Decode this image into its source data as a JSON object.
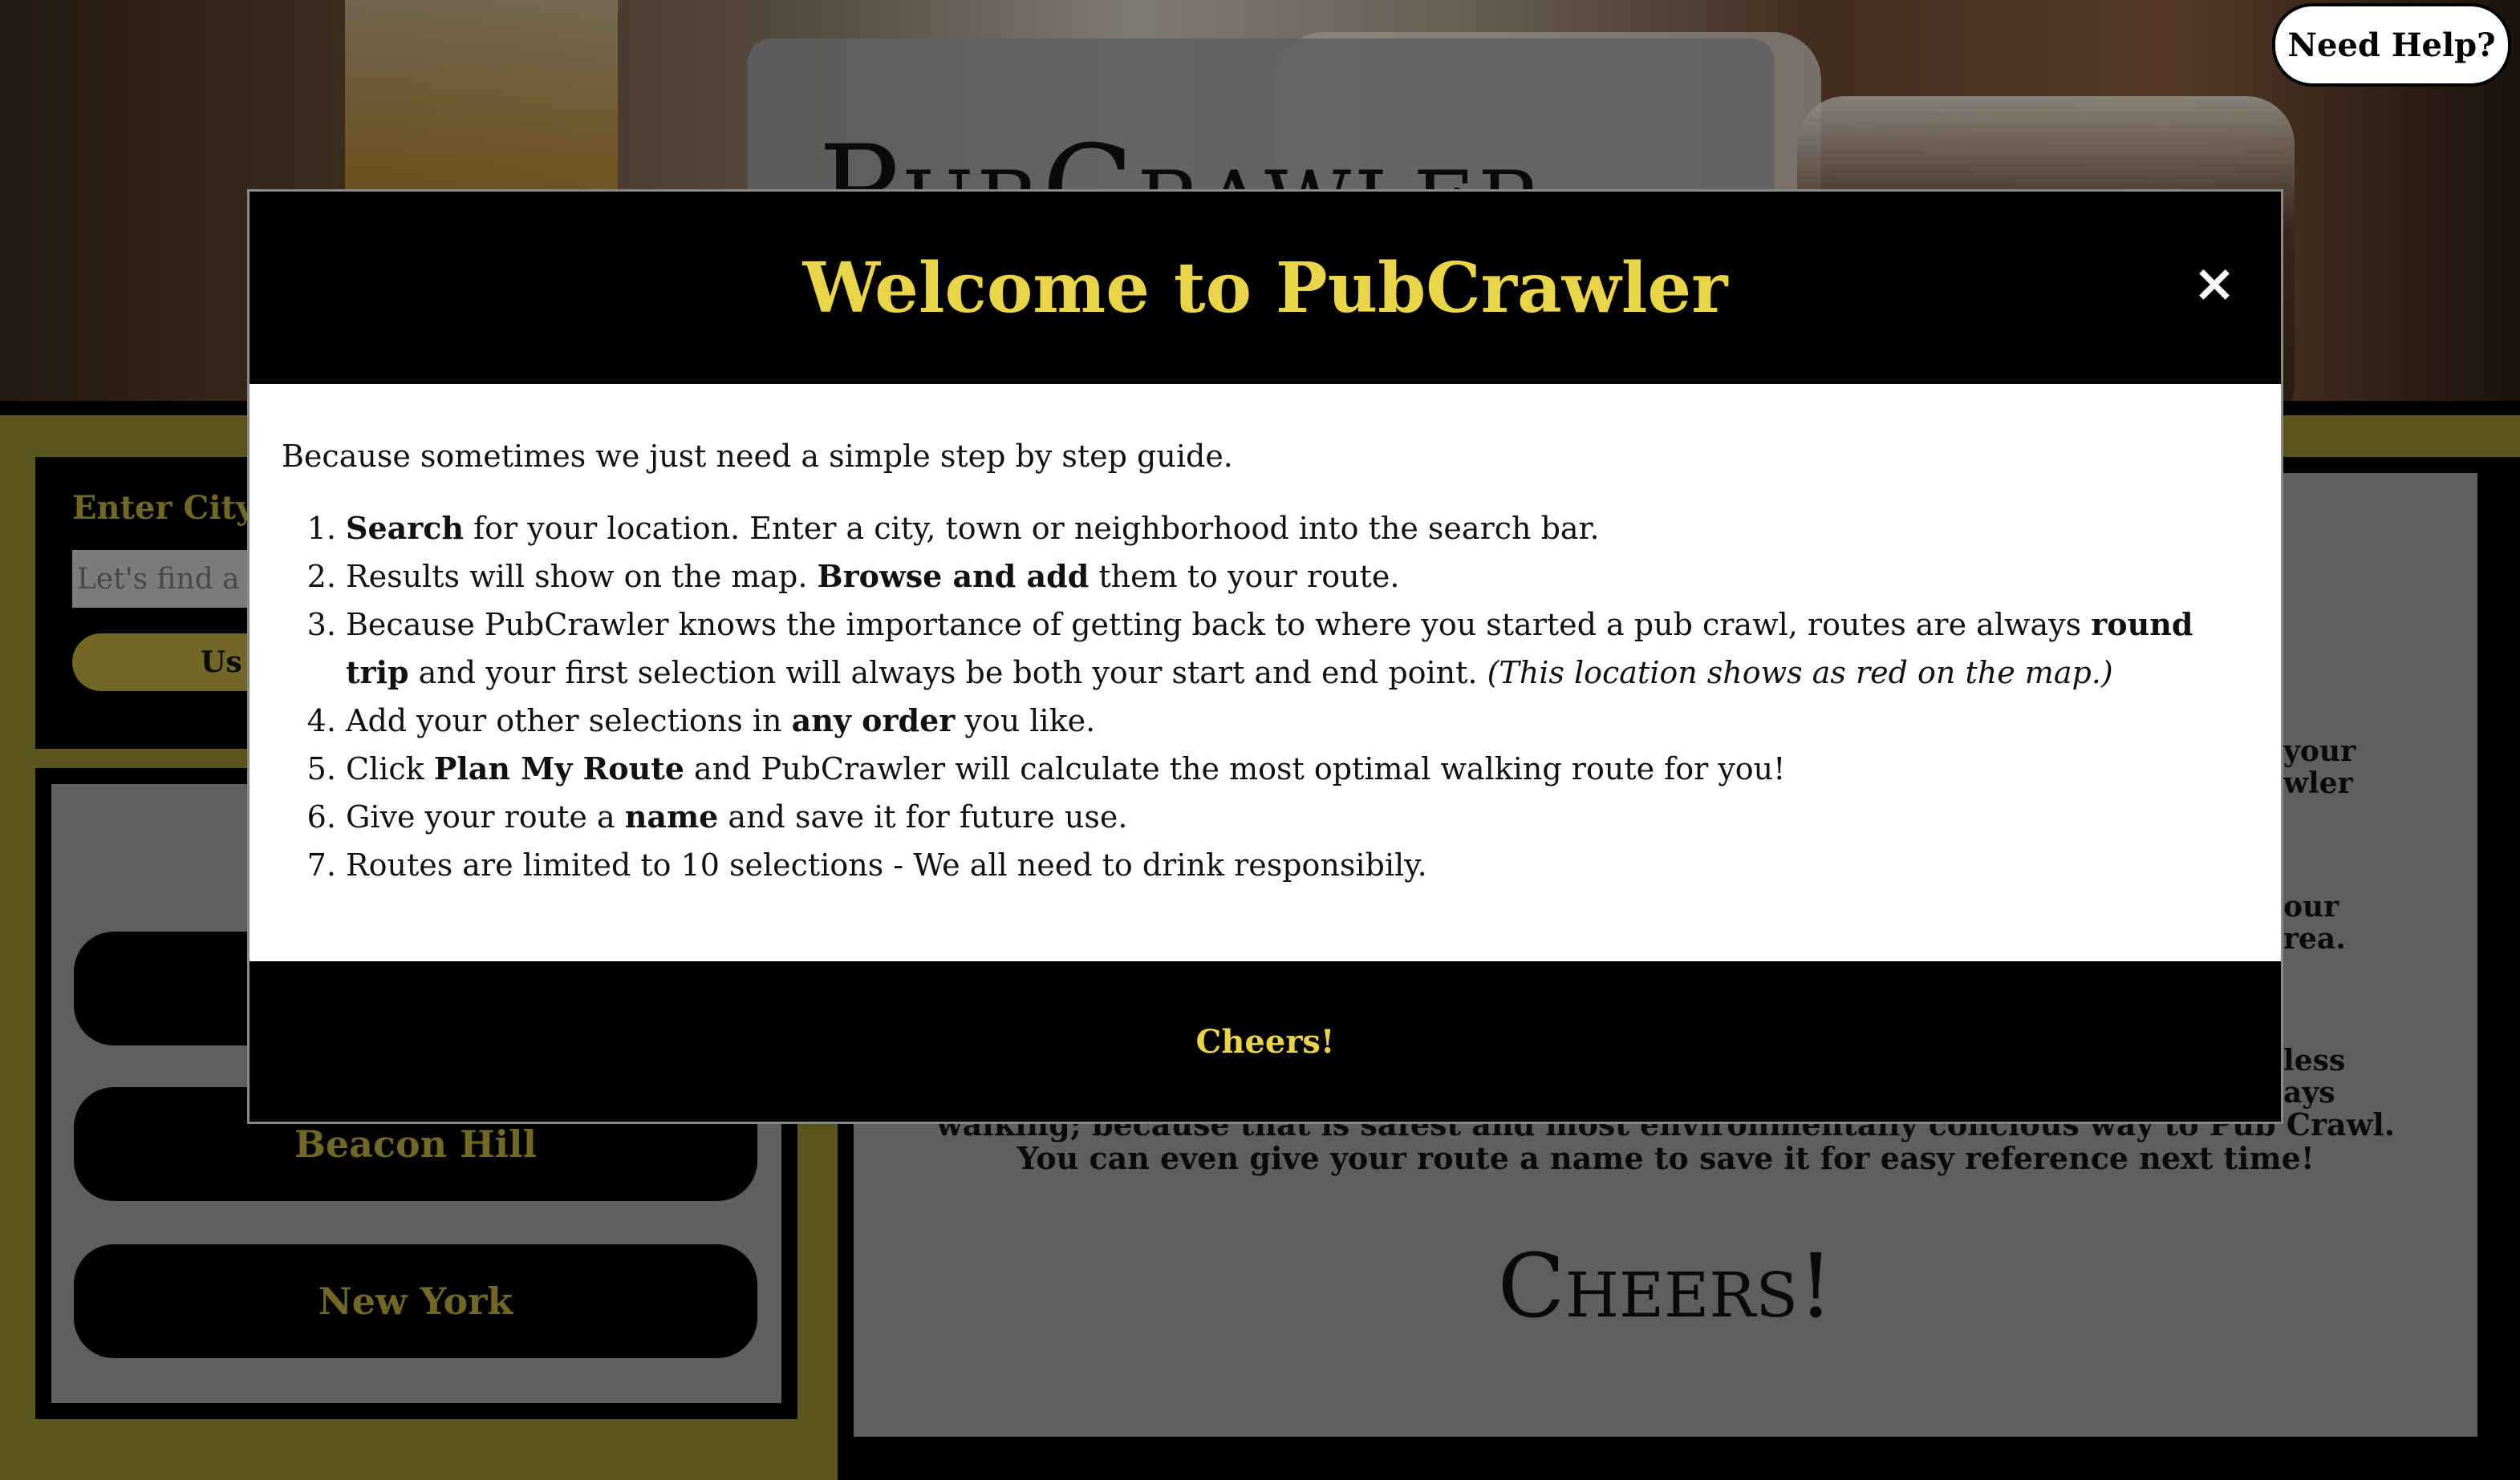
{
  "hero": {
    "logo_text": "PubCrawler"
  },
  "help_button": {
    "label": "Need Help?"
  },
  "search": {
    "label": "Enter City",
    "placeholder": "Let's find a b",
    "button_label": "Us"
  },
  "cities": [
    {
      "label": ""
    },
    {
      "label": "Beacon Hill"
    },
    {
      "label": "New York"
    }
  ],
  "info": {
    "fragments": [
      "your",
      "wler",
      "our",
      "rea.",
      "less",
      "ays"
    ],
    "line1": "walking; because that is safest and most environmentally concious way to Pub Crawl.",
    "line2": "You can even give your route a name to save it for easy reference next time!",
    "cheers": "Cheers!"
  },
  "modal": {
    "title": "Welcome to PubCrawler",
    "close_symbol": "×",
    "intro": "Because sometimes we just need a simple step by step guide.",
    "steps": [
      {
        "b1": "Search",
        "t1": " for your location. Enter a city, town or neighborhood into the search bar."
      },
      {
        "t0": "Results will show on the map. ",
        "b1": "Browse and add",
        "t1": " them to your route."
      },
      {
        "t0": "Because PubCrawler knows the importance of getting back to where you started a pub crawl, routes are always ",
        "b1": "round trip",
        "t1": " and your first selection will always be both your start and end point. ",
        "i1": "(This location shows as red on the map.)"
      },
      {
        "t0": "Add your other selections in ",
        "b1": "any order",
        "t1": " you like."
      },
      {
        "t0": "Click ",
        "b1": "Plan My Route",
        "t1": " and PubCrawler will calculate the most optimal walking route for you!"
      },
      {
        "t0": "Give your route a ",
        "b1": "name",
        "t1": " and save it for future use."
      },
      {
        "t0": "Routes are limited to 10 selections - We all need to drink responsibily."
      }
    ],
    "footer_button": "Cheers!"
  },
  "colors": {
    "accent": "#e9d44a",
    "olive": "#948a30",
    "panel": "#000000"
  }
}
